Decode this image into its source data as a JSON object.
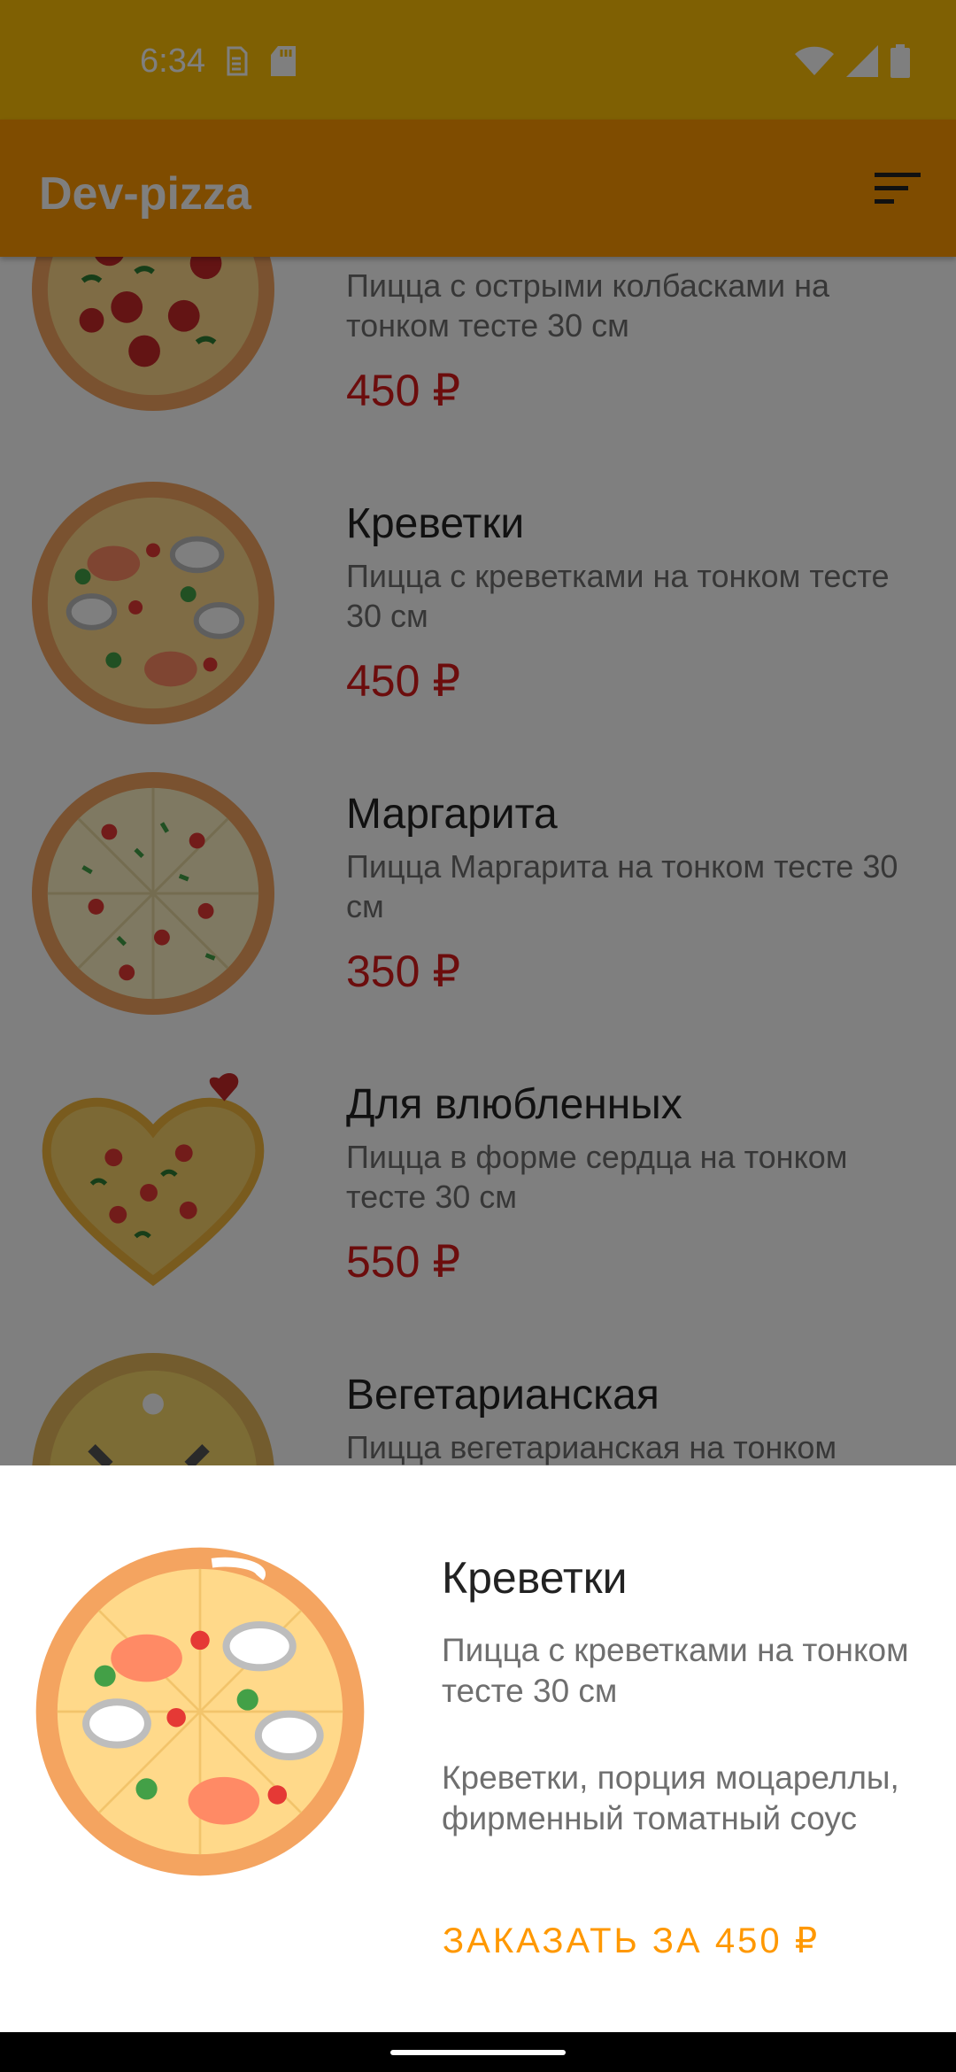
{
  "status_bar": {
    "time": "6:34",
    "left_icons": [
      "sim-icon",
      "sd-card-icon"
    ],
    "right_icons": [
      "wifi-icon",
      "signal-icon",
      "battery-icon"
    ]
  },
  "app_bar": {
    "title": "Dev-pizza",
    "action_icon": "filter-icon"
  },
  "menu": {
    "items": [
      {
        "name": "",
        "description": "Пицца с острыми колбасками на тонком тесте 30 см",
        "price": "450 ₽",
        "image": "pizza-pepperoni-image"
      },
      {
        "name": "Креветки",
        "description": "Пицца с креветками на тонком тесте 30 см",
        "price": "450 ₽",
        "image": "pizza-shrimp-image"
      },
      {
        "name": "Маргарита",
        "description": "Пицца Маргарита на тонком тесте 30 см",
        "price": "350 ₽",
        "image": "pizza-margarita-image"
      },
      {
        "name": "Для влюбленных",
        "description": "Пицца в форме сердца на тонком тесте 30 см",
        "price": "550 ₽",
        "image": "pizza-heart-image"
      },
      {
        "name": "Вегетарианская",
        "description": "Пицца вегетарианская на тонком",
        "price": "",
        "image": "pizza-veggie-image"
      }
    ]
  },
  "sheet": {
    "name": "Креветки",
    "description": "Пицца с креветками на тонком тесте 30 см",
    "ingredients": "Креветки, порция моцареллы, фирменный томатный соус",
    "order_label": "ЗАКАЗАТЬ ЗА 450 ₽",
    "image": "pizza-shrimp-image"
  },
  "colors": {
    "primary": "#FF9800",
    "status": "#FFC107",
    "price": "#D81B1B"
  }
}
